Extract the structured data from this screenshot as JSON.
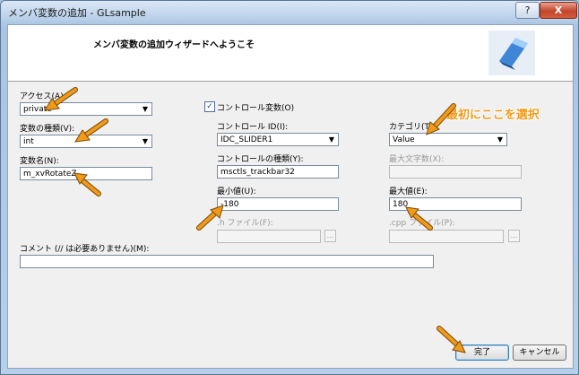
{
  "window": {
    "title": "メンバ変数の追加 - GLsample",
    "help_label": "?",
    "close_label": "X"
  },
  "banner": {
    "title": "メンバ変数の追加ウィザードへようこそ",
    "icon": "wizard-cube-icon"
  },
  "fields": {
    "access": {
      "label": "アクセス(A):",
      "value": "private"
    },
    "var_type": {
      "label": "変数の種類(V):",
      "value": "int"
    },
    "var_name": {
      "label": "変数名(N):",
      "value": "m_xvRotateZ"
    },
    "control_var": {
      "label": "コントロール変数(O)",
      "checked": true,
      "check_glyph": "✓"
    },
    "control_id": {
      "label": "コントロール ID(I):",
      "value": "IDC_SLIDER1"
    },
    "control_type": {
      "label": "コントロールの種類(Y):",
      "value": "msctls_trackbar32"
    },
    "min_value": {
      "label": "最小値(U):",
      "value": "-180"
    },
    "h_file": {
      "label": ".h ファイル(F):",
      "value": "",
      "browse": "..."
    },
    "category": {
      "label": "カテゴリ(T):",
      "value": "Value"
    },
    "max_chars": {
      "label": "最大文字数(X):",
      "value": ""
    },
    "max_value": {
      "label": "最大値(E):",
      "value": "180"
    },
    "cpp_file": {
      "label": ".cpp ファイル(P):",
      "value": "",
      "browse": "..."
    },
    "comment": {
      "label": "コメント (// は必要ありません)(M):",
      "value": ""
    }
  },
  "buttons": {
    "finish": "完了",
    "cancel": "キャンセル"
  },
  "annotation": {
    "callout_text": "最初にここを選択",
    "color": "#f19a1a"
  },
  "colors": {
    "accent": "#f19a1a",
    "window_frame": "#a9c4e0",
    "dialog_bg": "#f0f0f0"
  }
}
